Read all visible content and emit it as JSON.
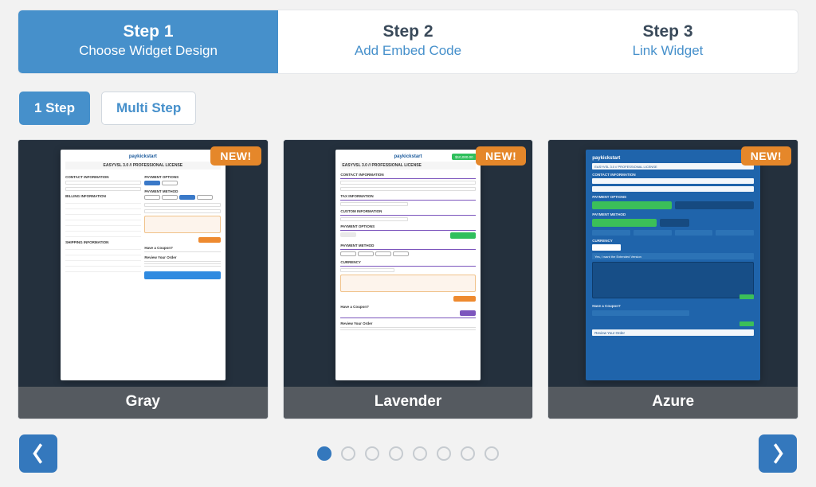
{
  "steps": [
    {
      "title": "Step 1",
      "sub": "Choose Widget Design",
      "active": true
    },
    {
      "title": "Step 2",
      "sub": "Add Embed Code",
      "active": false
    },
    {
      "title": "Step 3",
      "sub": "Link Widget",
      "active": false
    }
  ],
  "modes": {
    "one_step": "1 Step",
    "multi_step": "Multi Step"
  },
  "badge_new": "NEW!",
  "themes": [
    {
      "name": "Gray"
    },
    {
      "name": "Lavender"
    },
    {
      "name": "Azure"
    }
  ],
  "pagination": {
    "dot_count": 8,
    "active_index": 0
  },
  "mock": {
    "brand": "paykickstart",
    "license_title": "EASYVSL 3.0 // PROFESSIONAL LICENSE",
    "contact": "CONTACT INFORMATION",
    "billing": "BILLING INFORMATION",
    "shipping": "SHIPPING INFORMATION",
    "tax": "TAX INFORMATION",
    "custom": "CUSTOM INFORMATION",
    "payopt": "PAYMENT OPTIONS",
    "paymethod": "PAYMENT METHOD",
    "currency": "CURRENCY",
    "review": "Review Your Order",
    "coupon": "Have a Coupon?",
    "ext": "Yes, I want the Extended Version",
    "ribbon": "$10,000.00"
  }
}
